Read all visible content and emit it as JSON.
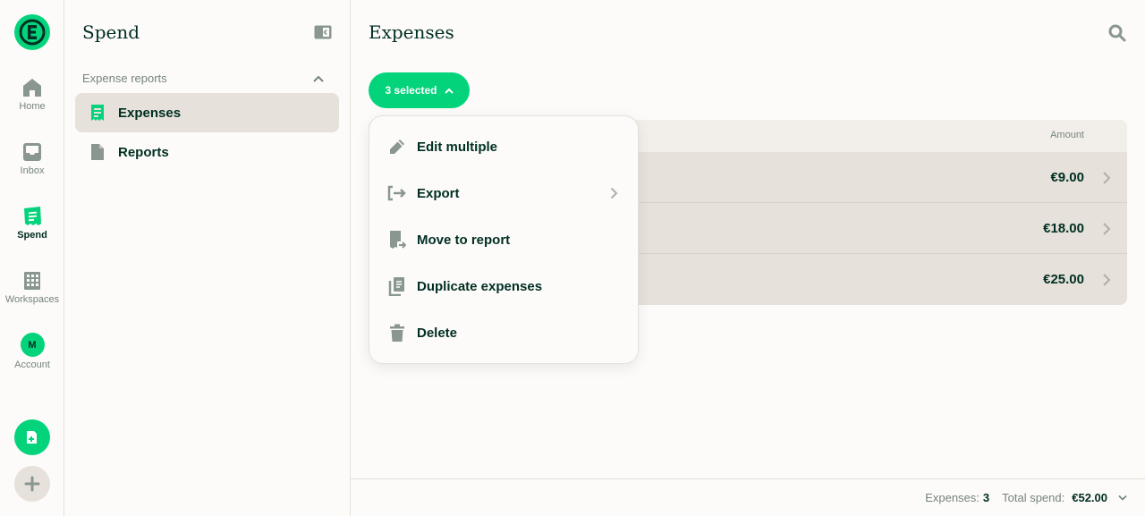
{
  "nav": {
    "items": [
      {
        "label": "Home"
      },
      {
        "label": "Inbox"
      },
      {
        "label": "Spend"
      },
      {
        "label": "Workspaces"
      },
      {
        "label": "Account",
        "avatar_initial": "M"
      }
    ]
  },
  "sidebar": {
    "title": "Spend",
    "section_label": "Expense reports",
    "items": [
      {
        "label": "Expenses"
      },
      {
        "label": "Reports"
      }
    ]
  },
  "main": {
    "title": "Expenses",
    "selection_label": "3 selected",
    "table": {
      "amount_header": "Amount",
      "rows": [
        {
          "amount": "€9.00"
        },
        {
          "amount": "€18.00"
        },
        {
          "amount": "€25.00"
        }
      ]
    }
  },
  "menu": {
    "items": [
      {
        "label": "Edit multiple"
      },
      {
        "label": "Export"
      },
      {
        "label": "Move to report"
      },
      {
        "label": "Duplicate expenses"
      },
      {
        "label": "Delete"
      }
    ]
  },
  "footer": {
    "expenses_label": "Expenses:",
    "expenses_count": "3",
    "total_label": "Total spend:",
    "total_value": "€52.00"
  },
  "colors": {
    "accent": "#03d47c",
    "text": "#002e22",
    "muted": "#76847e",
    "selected_bg": "#e6e1da"
  }
}
